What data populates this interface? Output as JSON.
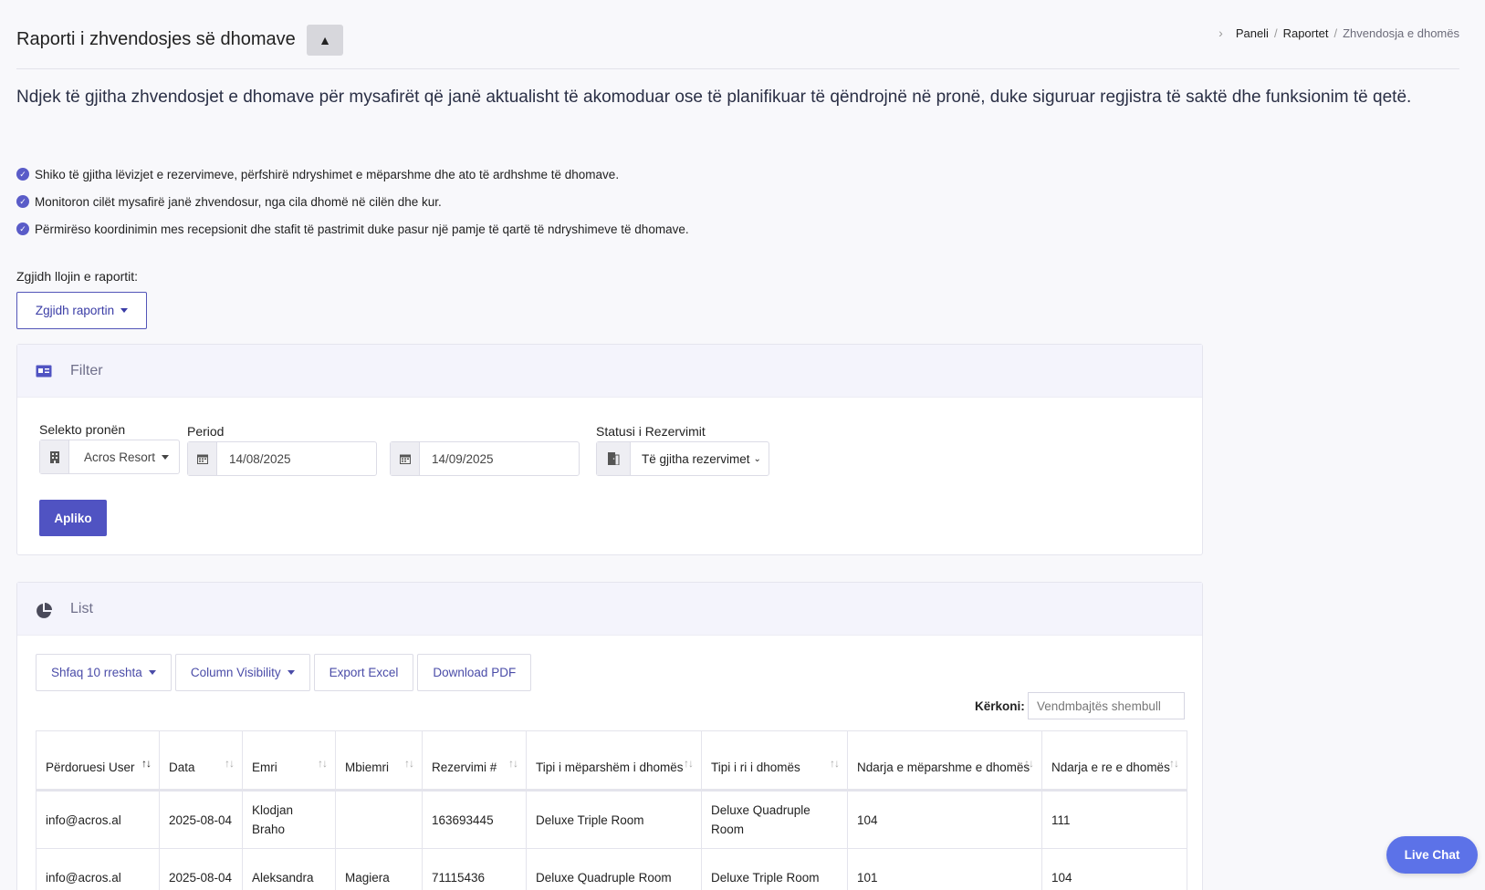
{
  "page": {
    "title": "Raporti i zhvendosjes së dhomave",
    "collapse_symbol": "▲",
    "breadcrumb": [
      "Paneli",
      "Raportet",
      "Zhvendosja e dhomës"
    ],
    "intro": "Ndjek të gjitha zhvendosjet e dhomave për mysafirët që janë aktualisht të akomoduar ose të planifikuar të qëndrojnë në pronë, duke siguruar regjistra të saktë dhe funksionim të qetë.",
    "bullets": [
      "Shiko të gjitha lëvizjet e rezervimeve, përfshirë ndryshimet e mëparshme dhe ato të ardhshme të dhomave.",
      "Monitoron cilët mysafirë janë zhvendosur, nga cila dhomë në cilën dhe kur.",
      "Përmirëso koordinimin mes recepsionit dhe stafit të pastrimit duke pasur një pamje të qartë të ndryshimeve të dhomave."
    ],
    "report_label": "Zgjidh llojin e raportit:",
    "report_dropdown": "Zgjidh raportin"
  },
  "filter": {
    "title": "Filter",
    "property_label": "Selekto pronën",
    "property_value": "Acros Resort",
    "period_label": "Period",
    "date_from": "14/08/2025",
    "date_to": "14/09/2025",
    "status_label": "Statusi i Rezervimit",
    "status_value": "Të gjitha rezervimet",
    "apply": "Apliko"
  },
  "list": {
    "title": "List",
    "tools": {
      "rows": "Shfaq 10 rreshta",
      "columns": "Column Visibility",
      "excel": "Export Excel",
      "pdf": "Download PDF"
    },
    "search_label": "Kërkoni:",
    "search_placeholder": "Vendmbajtës shembull",
    "headers": [
      "Përdoruesi User",
      "Data",
      "Emri",
      "Mbiemri",
      "Rezervimi #",
      "Tipi i mëparshëm i dhomës",
      "Tipi i ri i dhomës",
      "Ndarja e mëparshme e dhomës",
      "Ndarja e re e dhomës"
    ],
    "rows": [
      [
        "info@acros.al",
        "2025-08-04",
        "Klodjan Braho",
        "",
        "163693445",
        "Deluxe Triple Room",
        "Deluxe Quadruple Room",
        "104",
        "111"
      ],
      [
        "info@acros.al",
        "2025-08-04",
        "Aleksandra",
        "Magiera",
        "71115436",
        "Deluxe Quadruple Room",
        "Deluxe Triple Room",
        "101",
        "104"
      ]
    ]
  },
  "live_chat": "Live Chat",
  "colors": {
    "accent": "#5053c2",
    "live_chat": "#5c72e8"
  }
}
